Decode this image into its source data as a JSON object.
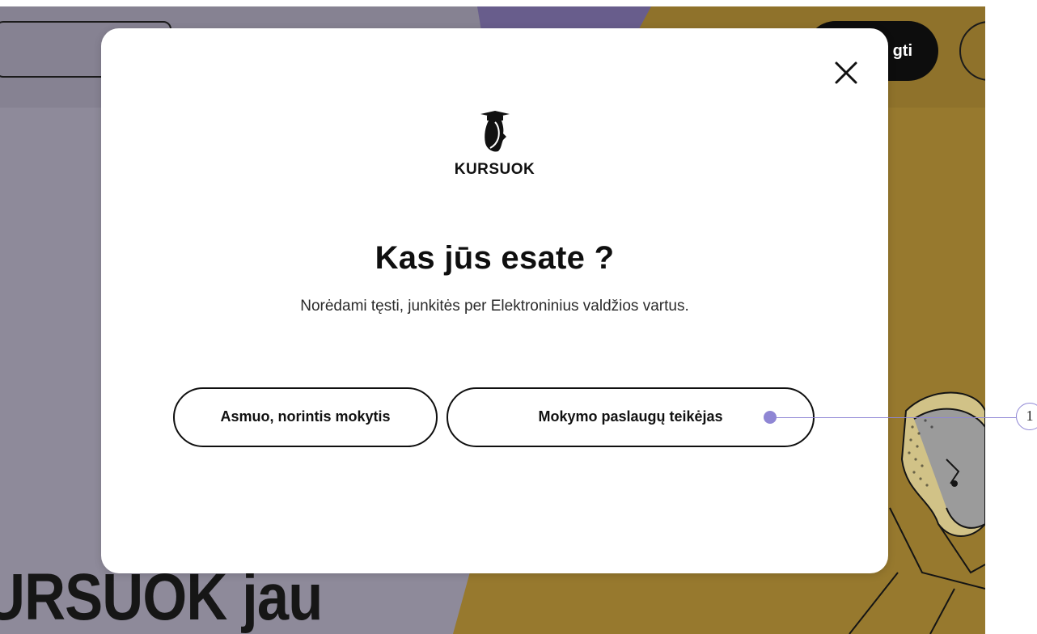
{
  "background": {
    "login_button_label": "gti",
    "hero_title": "URSUOK jau"
  },
  "modal": {
    "logo_text": "KURSUOK",
    "title": "Kas jūs esate ?",
    "subtitle": "Norėdami tęsti, junkitės per Elektroninius valdžios vartus.",
    "buttons": {
      "learner": "Asmuo, norintis mokytis",
      "provider": "Mokymo paslaugų teikėjas"
    }
  },
  "annotation": {
    "marker_label": "1"
  },
  "colors": {
    "background_lavender": "#8e8a9a",
    "background_mustard": "#97792e",
    "top_accent": "#6e6294",
    "annotation": "#8f86d4"
  },
  "icons": {
    "close": "close-icon",
    "logo": "kursuok-logo-icon"
  }
}
